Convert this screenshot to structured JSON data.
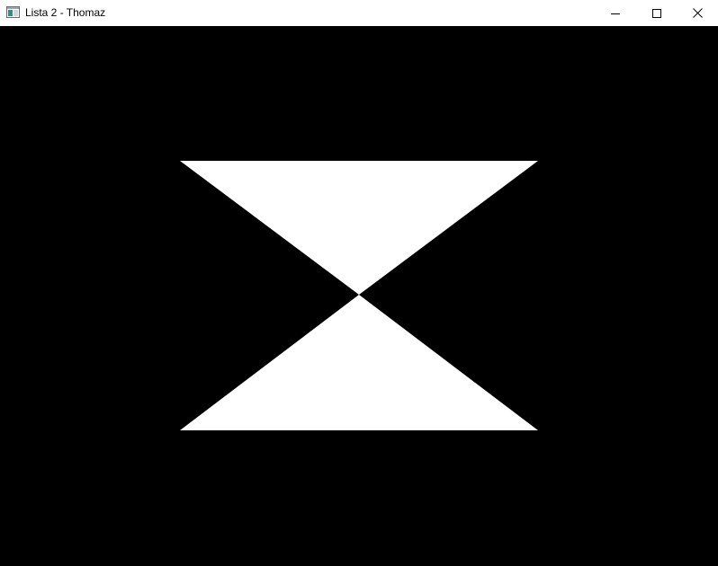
{
  "window": {
    "title": "Lista 2 - Thomaz",
    "controls": {
      "minimize_icon": "minimize-icon",
      "maximize_icon": "maximize-icon",
      "close_icon": "close-icon"
    }
  },
  "canvas": {
    "background_color": "#000000",
    "shape_color": "#ffffff",
    "shape": "hourglass (two triangles meeting at a point)"
  }
}
